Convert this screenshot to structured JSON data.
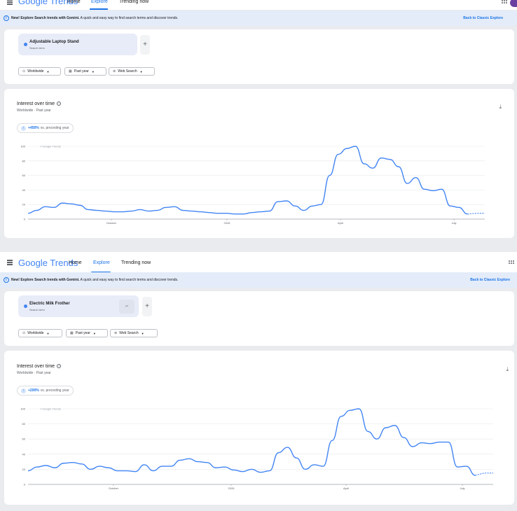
{
  "app": {
    "logo": "Google Trends",
    "tabs": [
      "Home",
      "Explore",
      "Trending now"
    ],
    "active_tab": "Explore"
  },
  "banner": {
    "bold": "New! Explore Search trends with Gemini.",
    "text": " A quick and easy way to find search terms and discover trends.",
    "back_link": "Back to Classic Explore"
  },
  "filters": {
    "location": "Worldwide",
    "period": "Past year",
    "property": "Web Search"
  },
  "card_title": "Interest over time",
  "card_sub": "Worldwide · Past year",
  "watermark": "Google Trends",
  "compare_suffix": "vs. preceding year",
  "panels": [
    {
      "term": "Adjustable Laptop Stand",
      "term_sub": "Search term",
      "change": "+450%"
    },
    {
      "term": "Electric Milk Frother",
      "term_sub": "Search term",
      "change": "+200%"
    }
  ],
  "colors": {
    "accent": "#1a73e8",
    "line": "#4285f4",
    "banner": "#e4ecf9"
  },
  "chart_data": [
    {
      "type": "line",
      "title": "Interest over time",
      "series": [
        {
          "name": "Adjustable Laptop Stand",
          "values": [
            8,
            12,
            17,
            16,
            22,
            21,
            19,
            13,
            12,
            11,
            10,
            10,
            11,
            13,
            11,
            12,
            16,
            17,
            12,
            11,
            10,
            9,
            8,
            8,
            7,
            7,
            9,
            10,
            11,
            24,
            25,
            18,
            12,
            18,
            20,
            60,
            89,
            97,
            100,
            76,
            70,
            84,
            82,
            72,
            49,
            57,
            41,
            39,
            41,
            18,
            16,
            7,
            8,
            8
          ]
        }
      ],
      "x_ticks": [
        "October",
        "2026",
        "April",
        "July"
      ],
      "ylim": [
        0,
        100
      ],
      "y_ticks": [
        0,
        20,
        40,
        60,
        80,
        100
      ],
      "grid": true
    },
    {
      "type": "line",
      "title": "Interest over time",
      "series": [
        {
          "name": "Electric Milk Frother",
          "values": [
            18,
            23,
            25,
            22,
            28,
            29,
            27,
            20,
            24,
            22,
            18,
            18,
            17,
            26,
            18,
            24,
            24,
            32,
            34,
            30,
            29,
            22,
            23,
            19,
            17,
            20,
            16,
            18,
            42,
            49,
            35,
            20,
            26,
            24,
            58,
            90,
            98,
            100,
            70,
            60,
            75,
            78,
            62,
            50,
            55,
            54,
            56,
            56,
            23,
            24,
            12,
            15,
            15
          ]
        }
      ],
      "x_ticks": [
        "October",
        "2026",
        "April",
        "July"
      ],
      "ylim": [
        0,
        100
      ],
      "y_ticks": [
        0,
        20,
        40,
        60,
        80,
        100
      ],
      "grid": true
    }
  ]
}
